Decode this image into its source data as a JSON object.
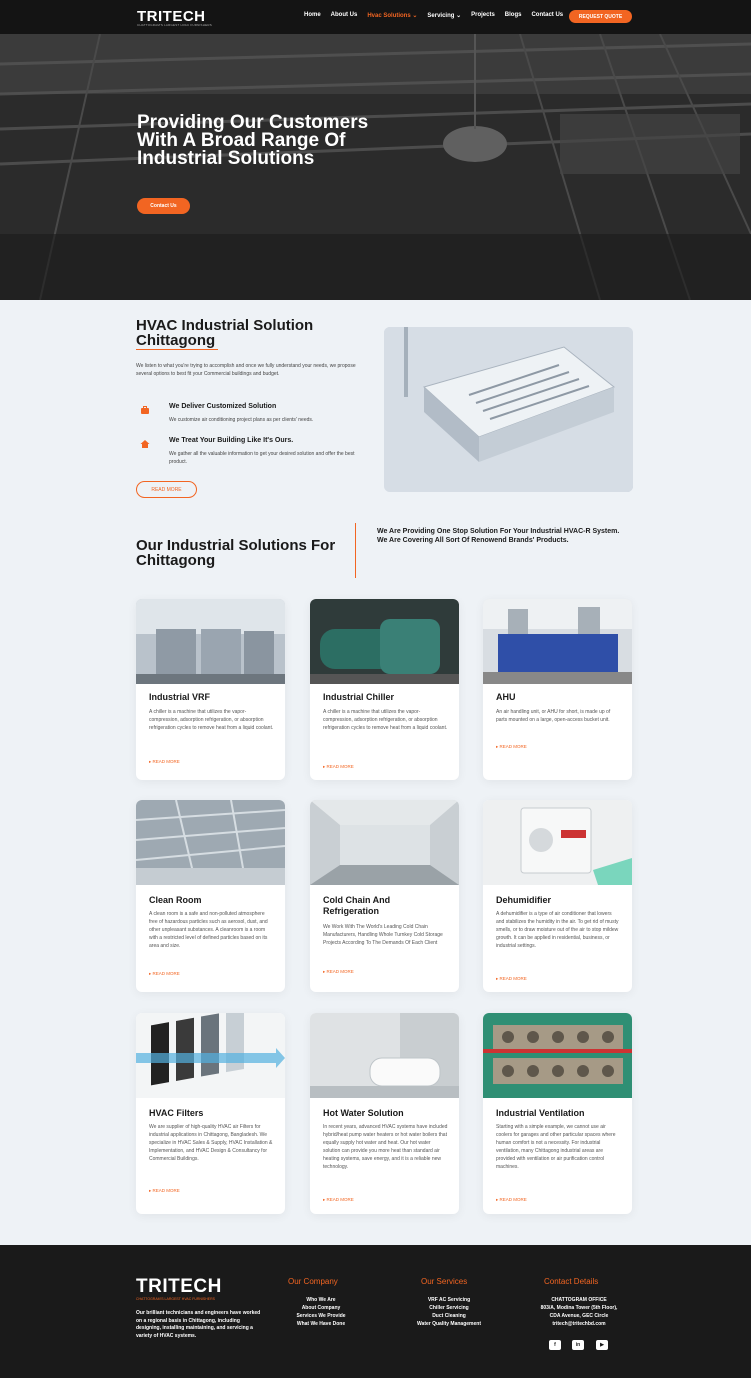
{
  "nav": {
    "logo": "TRITECH",
    "logo_tagline": "CHATTOGRAM'S LARGEST HVAC FURNISHERS",
    "links": [
      "Home",
      "About Us",
      "Hvac Solutions ⌄",
      "Servicing ⌄",
      "Projects",
      "Blogs",
      "Contact Us"
    ],
    "cta": "REQUEST QUOTE"
  },
  "hero": {
    "title": "Providing Our Customers With A Broad Range Of Industrial Solutions",
    "button": "Contact Us"
  },
  "intro": {
    "title": "HVAC Industrial Solution Chittagong",
    "text": "We listen to what you're trying to accomplish and once we fully understand your needs, we propose several options to best fit your Commercial buildings and budget.",
    "features": [
      {
        "icon": "toolbox-icon",
        "title": "We Deliver Customized Solution",
        "text": "We customize air conditioning project plans as per clients' needs."
      },
      {
        "icon": "home-icon",
        "title": "We Treat Your Building Like It's Ours.",
        "text": "We gather all the valuable information to get your desired solution and offer the best product."
      }
    ],
    "read_more": "READ MORE"
  },
  "solutions": {
    "title": "Our Industrial Solutions For Chittagong",
    "subtitle": "We Are Providing One Stop Solution For Your Industrial HVAC-R System. We Are Covering All Sort Of Renowend Brands' Products.",
    "cards": [
      {
        "title": "Industrial VRF",
        "text": "A chiller is a machine that utilizes the vapor-compression, adsorption refrigeration, or absorption refrigeration cycles to remove heat from a liquid coolant.",
        "link": "READ MORE"
      },
      {
        "title": "Industrial Chiller",
        "text": "A chiller is a machine that utilizes the vapor-compression, adsorption refrigeration, or absorption refrigeration cycles to remove heat from a liquid coolant.",
        "link": "READ MORE"
      },
      {
        "title": "AHU",
        "text": "An air handling unit, or AHU for short, is made up of parts mounted on a large, open-access bucket unit.",
        "link": "READ MORE"
      },
      {
        "title": "Clean Room",
        "text": "A clean room is a safe and non-polluted atmosphere free of hazardous particles such as aerosol, dust, and other unpleasant substances. A cleanroom is a room with a restricted level of defined particles based on its area and size.",
        "link": "READ MORE"
      },
      {
        "title": "Cold Chain And Refrigeration",
        "text": "We Work With The World's Leading Cold Chain Manufacturers, Handling Whole Turnkey Cold Storage Projects According To The Demands Of Each Client",
        "link": "READ MORE"
      },
      {
        "title": "Dehumidifier",
        "text": "A dehumidifier is a type of air conditioner that lowers and stabilizes the humidity in the air. To get rid of musty smells, or to draw moisture out of the air to stop mildew growth. It can be applied in residential, business, or industrial settings.",
        "link": "READ MORE"
      },
      {
        "title": "HVAC Filters",
        "text": "We are supplier of high-quality HVAC air Filters for industrial applications in Chittagong, Bangladesh. We specialize in HVAC Sales & Supply, HVAC Installation & Implementation, and HVAC Design & Consultancy for Commercial Buildings.",
        "link": "READ MORE"
      },
      {
        "title": "Hot Water Solution",
        "text": "In recent years, advanced HVAC systems have included hybrid/heat pump water heaters or hot water boilers that equally supply hot water and heat. Our hot water solution can provide you more heat than standard air heating systems, save energy, and it is a reliable new technology.",
        "link": "READ MORE"
      },
      {
        "title": "Industrial Ventilation",
        "text": "Starting with a simple example, we cannot use air coolers for garages and other particular spaces where human comfort is not a necessity. For industrial ventilation, many Chittagong industrial areas are provided with ventilation or air purification control machines.",
        "link": "READ MORE"
      }
    ]
  },
  "footer": {
    "logo": "TRITECH",
    "logo_tagline": "CHATTOGRAM'S LARGEST HVAC FURNISHERS",
    "about": "Our brilliant technicians and engineers have worked on a regional basis in Chittagong, including designing, installing maintaining, and servicing a variety of HVAC systems.",
    "company": {
      "heading": "Our Company",
      "items": [
        "Who We Are",
        "About Company",
        "Services We Provide",
        "What We Have Done"
      ]
    },
    "services": {
      "heading": "Our Services",
      "items": [
        "VRF AC Servicing",
        "Chiller Servicing",
        "Duct Cleaning",
        "Water Quality Management"
      ]
    },
    "contact": {
      "heading": "Contact Details",
      "items": [
        "CHATTOGRAM OFFICE",
        "803/A, Modina Tower (5th Floor),",
        "CDA Avenue, GEC Circle",
        "tritech@tritechbd.com"
      ]
    },
    "social": [
      "f",
      "in",
      "▶"
    ]
  }
}
